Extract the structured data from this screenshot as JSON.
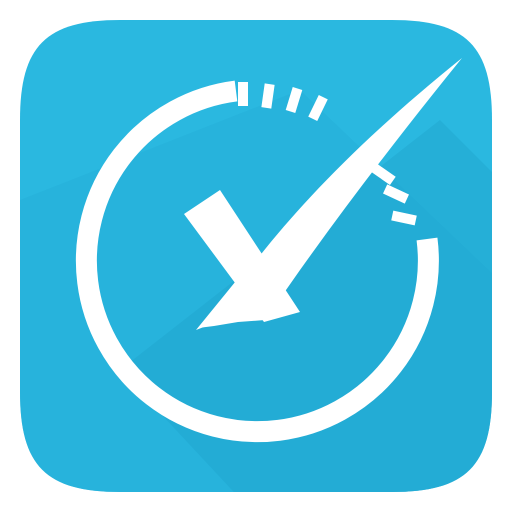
{
  "icon": {
    "name": "timer-checkmark-app-icon",
    "colors": {
      "tile": "#2ab8e0",
      "tile_shadow_band": "#22a8d1",
      "glyph": "#ffffff",
      "glyph_shadow": "#1d8fb3"
    }
  }
}
